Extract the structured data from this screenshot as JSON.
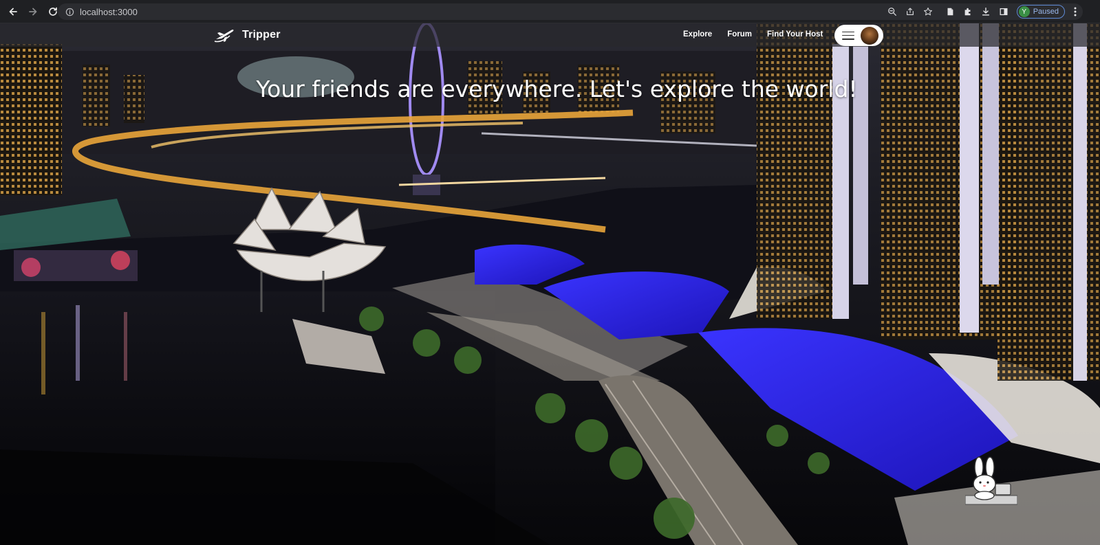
{
  "browser": {
    "url": "localhost:3000",
    "profile_initial": "Y",
    "profile_status": "Paused",
    "icons": [
      "back-icon",
      "forward-icon",
      "reload-icon",
      "info-icon",
      "zoom-icon",
      "share-icon",
      "star-icon",
      "reading-list-icon",
      "extensions-icon",
      "download-icon",
      "side-panel-icon",
      "kebab-menu-icon"
    ]
  },
  "site": {
    "brand": "Tripper",
    "nav": {
      "explore": "Explore",
      "forum": "Forum",
      "find_host": "Find Your Host"
    },
    "headline": "Your friends are everywhere. Let's explore the world!"
  },
  "colors": {
    "chrome_bg": "#1f2023",
    "omnibox_bg": "#2b2c30",
    "navbar_overlay": "rgba(40,40,44,0.72)",
    "accent_blue": "#2a2bd6"
  }
}
